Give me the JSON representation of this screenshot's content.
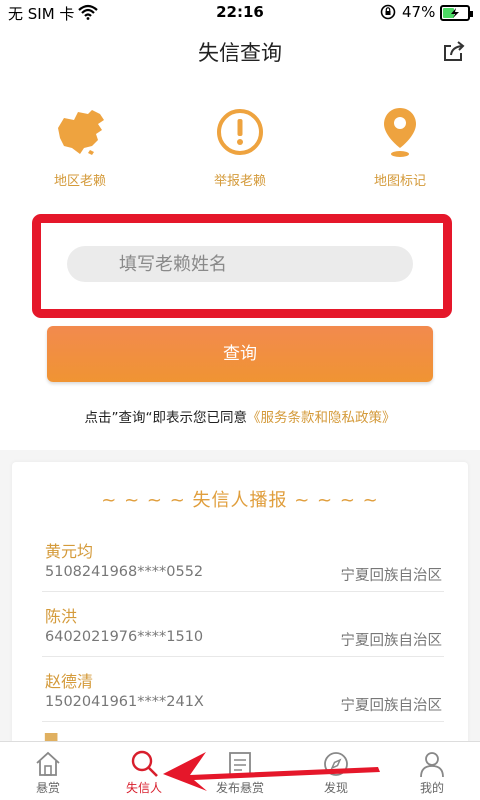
{
  "status_bar": {
    "carrier": "无 SIM 卡",
    "time": "22:16",
    "battery_percent": "47%",
    "battery_level": 0.47
  },
  "nav": {
    "title": "失信查询",
    "share_icon": "share-icon"
  },
  "features": [
    {
      "label": "地区老赖",
      "icon": "china-map-icon"
    },
    {
      "label": "举报老赖",
      "icon": "exclamation-circle-icon"
    },
    {
      "label": "地图标记",
      "icon": "location-pin-icon"
    }
  ],
  "search": {
    "placeholder": "填写老赖姓名"
  },
  "query_button": {
    "label": "查询"
  },
  "agreement": {
    "text": "点击”查询“即表示您已同意",
    "link": "《服务条款和隐私政策》"
  },
  "broadcast": {
    "title": "~ ~ ~ ~ 失信人播报 ~ ~ ~ ~",
    "entries": [
      {
        "name": "黄元均",
        "id": "5108241968****0552",
        "region": "宁夏回族自治区"
      },
      {
        "name": "陈洪",
        "id": "6402021976****1510",
        "region": "宁夏回族自治区"
      },
      {
        "name": "赵德清",
        "id": "1502041961****241X",
        "region": "宁夏回族自治区"
      }
    ]
  },
  "tabs": [
    {
      "label": "悬赏",
      "icon": "home-icon"
    },
    {
      "label": "失信人",
      "icon": "search-icon",
      "active": true
    },
    {
      "label": "发布悬赏",
      "icon": "document-icon"
    },
    {
      "label": "发现",
      "icon": "compass-icon"
    },
    {
      "label": "我的",
      "icon": "person-icon"
    }
  ],
  "colors": {
    "accent": "#d49a3a",
    "button": "#f0903d",
    "highlight": "#e5172a",
    "active_tab": "#d81e2c"
  }
}
